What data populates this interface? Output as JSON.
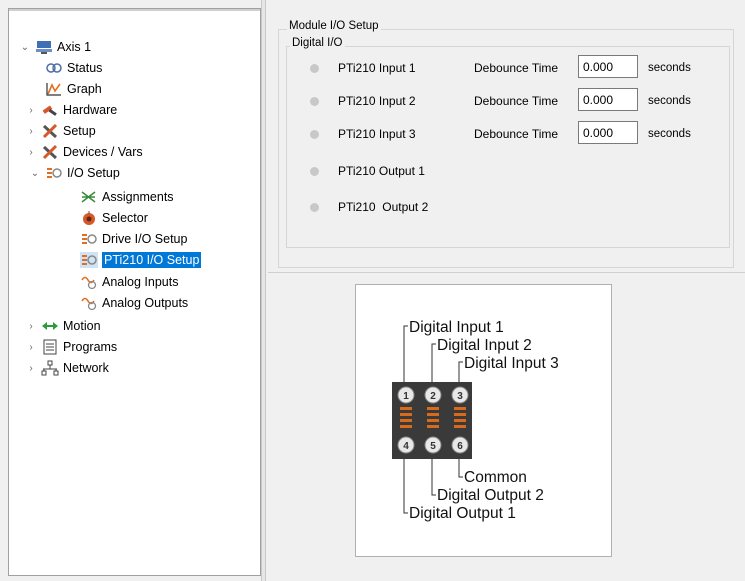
{
  "tree": {
    "items": [
      {
        "label": "Axis 1",
        "icon": "axis-icon",
        "expander": "⌄"
      },
      {
        "label": "Status",
        "icon": "status-icon"
      },
      {
        "label": "Graph",
        "icon": "graph-icon"
      },
      {
        "label": "Hardware",
        "icon": "hardware-icon",
        "expander": "›"
      },
      {
        "label": "Setup",
        "icon": "setup-icon",
        "expander": "›"
      },
      {
        "label": "Devices / Vars",
        "icon": "devices-icon",
        "expander": "›"
      },
      {
        "label": "I/O Setup",
        "icon": "io-setup-icon",
        "expander": "⌄"
      },
      {
        "label": "Assignments",
        "icon": "assignments-icon"
      },
      {
        "label": "Selector",
        "icon": "selector-icon"
      },
      {
        "label": "Drive I/O Setup",
        "icon": "drive-io-icon"
      },
      {
        "label": "PTi210 I/O Setup",
        "icon": "pti210-io-icon",
        "selected": true
      },
      {
        "label": "Analog Inputs",
        "icon": "analog-inputs-icon"
      },
      {
        "label": "Analog Outputs",
        "icon": "analog-outputs-icon"
      },
      {
        "label": "Motion",
        "icon": "motion-icon",
        "expander": "›"
      },
      {
        "label": "Programs",
        "icon": "programs-icon",
        "expander": "›"
      },
      {
        "label": "Network",
        "icon": "network-icon",
        "expander": "›"
      }
    ]
  },
  "module": {
    "title": "Module I/O Setup",
    "digital_title": "Digital I/O",
    "inputs": [
      {
        "label": "PTi210 Input 1",
        "debounce_label": "Debounce Time",
        "value": "0.000",
        "unit": "seconds"
      },
      {
        "label": "PTi210 Input 2",
        "debounce_label": "Debounce Time",
        "value": "0.000",
        "unit": "seconds"
      },
      {
        "label": "PTi210 Input 3",
        "debounce_label": "Debounce Time",
        "value": "0.000",
        "unit": "seconds"
      }
    ],
    "outputs": [
      {
        "label": "PTi210 Output 1"
      },
      {
        "label": "PTi210  Output 2"
      }
    ]
  },
  "diagram": {
    "labels": {
      "in1": "Digital Input 1",
      "in2": "Digital Input 2",
      "in3": "Digital Input 3",
      "common": "Common",
      "out2": "Digital Output 2",
      "out1": "Digital Output 1"
    },
    "pins_top": [
      "1",
      "2",
      "3"
    ],
    "pins_bottom": [
      "4",
      "5",
      "6"
    ]
  },
  "colors": {
    "selection": "#0078d7",
    "led": "#c8c8c8",
    "terminal": "#333333",
    "terminal_spring": "#d86a1e"
  }
}
